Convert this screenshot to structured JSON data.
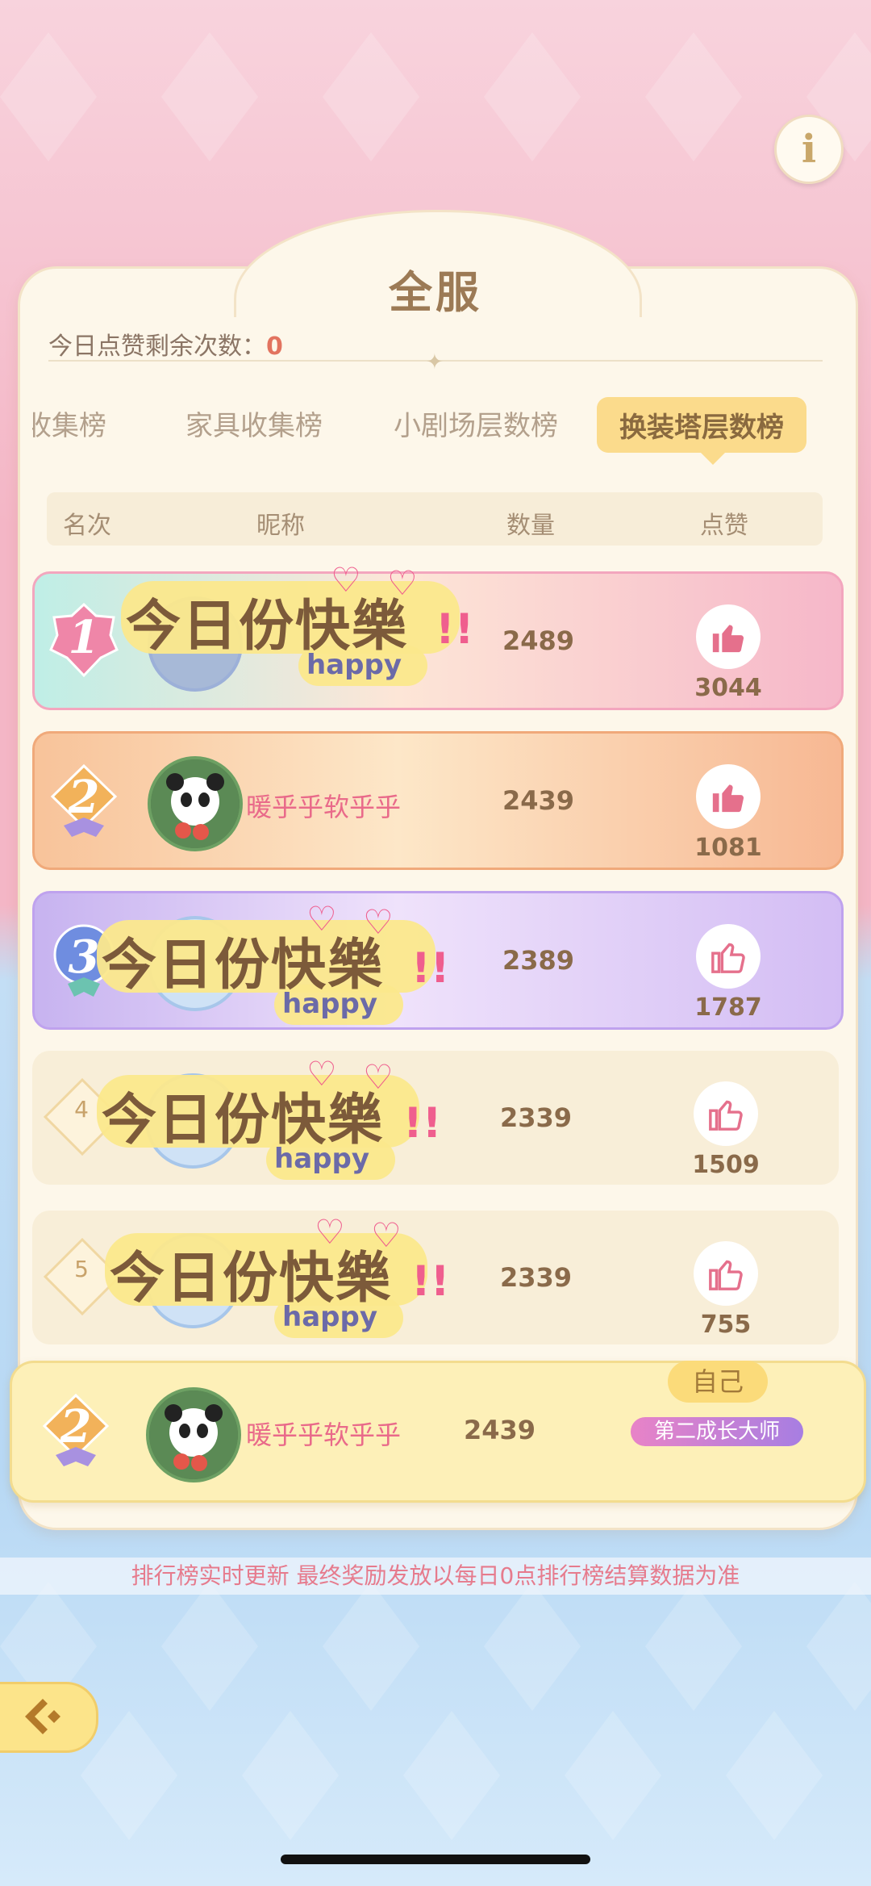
{
  "header": {
    "title": "全服",
    "likes_remaining_label": "今日点赞剩余次数：",
    "likes_remaining_value": "0"
  },
  "tabs": [
    {
      "label": "收集榜"
    },
    {
      "label": "家具收集榜"
    },
    {
      "label": "小剧场层数榜"
    },
    {
      "label": "换装塔层数榜",
      "active": true
    }
  ],
  "columns": {
    "rank": "名次",
    "nickname": "昵称",
    "count": "数量",
    "like": "点赞"
  },
  "rows": [
    {
      "rank": "1",
      "count": "2489",
      "likes": "3044",
      "sticker": "今日份快樂",
      "sticker_sub": "happy"
    },
    {
      "rank": "2",
      "nickname": "暖乎乎软乎乎",
      "count": "2439",
      "likes": "1081"
    },
    {
      "rank": "3",
      "count": "2389",
      "likes": "1787",
      "sticker": "今日份快樂",
      "sticker_sub": "happy"
    },
    {
      "rank": "4",
      "count": "2339",
      "likes": "1509",
      "sticker": "今日份快樂",
      "sticker_sub": "happy"
    },
    {
      "rank": "5",
      "count": "2339",
      "likes": "755",
      "sticker": "今日份快樂",
      "sticker_sub": "happy"
    }
  ],
  "self": {
    "tag": "自己",
    "rank": "2",
    "nickname": "暖乎乎软乎乎",
    "count": "2439",
    "title_badge": "第二成长大师"
  },
  "footer": {
    "tip": "排行榜实时更新 最终奖励发放以每日0点排行榜结算数据为准"
  },
  "icons": {
    "info": "info-icon",
    "like": "thumbs-up-icon",
    "back": "back-arrow-icon"
  },
  "colors": {
    "rank1": "#f6b7c9",
    "rank2": "#f7c49a",
    "rank3": "#d9c3f2",
    "plain": "#f8eed8",
    "self": "#fdf0b8",
    "accent": "#fbdb8c"
  }
}
